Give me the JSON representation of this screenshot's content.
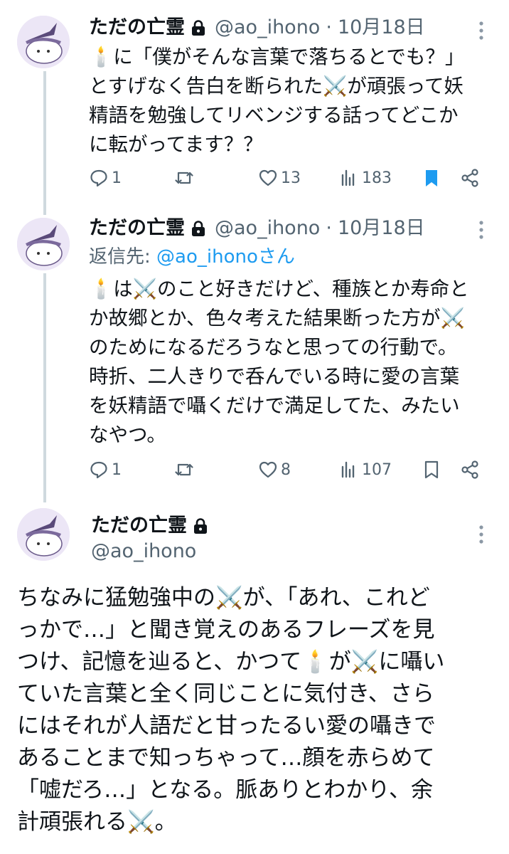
{
  "tweets": [
    {
      "display_name": "ただの亡霊",
      "handle": "@ao_ihono",
      "sep": "·",
      "date": "10月18日",
      "text": "🕯️に「僕がそんな言葉で落ちるとでも？」\nとすげなく告白を断られた⚔️が頑張って妖\n精語を勉強してリベンジする話ってどこか\nに転がってます？？",
      "replies": "1",
      "likes": "13",
      "views": "183",
      "bookmarked": true
    },
    {
      "display_name": "ただの亡霊",
      "handle": "@ao_ihono",
      "sep": "·",
      "date": "10月18日",
      "reply_prefix": "返信先: ",
      "reply_target": "@ao_ihonoさん",
      "text": "🕯️は⚔️のこと好きだけど、種族とか寿命と\nか故郷とか、色々考えた結果断った方が⚔️\nのためになるだろうなと思っての行動で。\n時折、二人きりで呑んでいる時に愛の言葉\nを妖精語で囁くだけで満足してた、みたい\nなやつ。",
      "replies": "1",
      "likes": "8",
      "views": "107",
      "bookmarked": false
    },
    {
      "display_name": "ただの亡霊",
      "handle": "@ao_ihono",
      "text": "ちなみに猛勉強中の⚔️が、「あれ、これど\nっかで…」と聞き覚えのあるフレーズを見\nつけ、記憶を辿ると、かつて🕯️が⚔️に囁い\nていた言葉と全く同じことに気付き、さら\nにはそれが人語だと甘ったるい愛の囁きで\nあることまで知っちゃって…顔を赤らめて\n「嘘だろ…」となる。脈ありとわかり、余\n計頑張れる⚔️。"
    }
  ],
  "icons": {
    "lock": "lock-icon",
    "more": "more-icon",
    "reply": "reply-icon",
    "retweet": "retweet-icon",
    "like": "like-icon",
    "views": "views-icon",
    "bookmark": "bookmark-icon",
    "share": "share-icon"
  },
  "colors": {
    "text": "#0f1419",
    "secondary": "#536471",
    "link": "#1d9bf0",
    "bookmark_active": "#1d9bf0",
    "thread_line": "#cfd9de"
  }
}
